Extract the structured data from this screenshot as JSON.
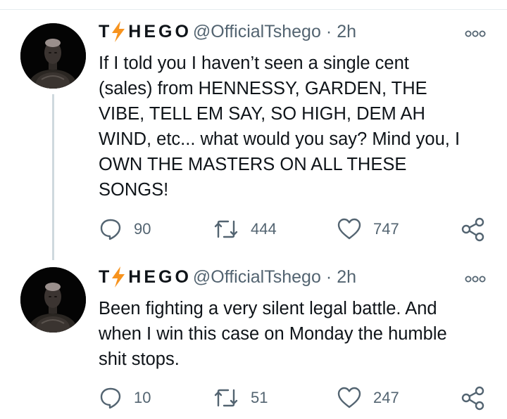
{
  "tweets": [
    {
      "name_pre": "T",
      "name_post": "HEGO",
      "handle": "@OfficialTshego",
      "separator": "·",
      "time": "2h",
      "text": "If I told you I haven’t seen a single cent\n(sales) from HENNESSY, GARDEN, THE\nVIBE, TELL EM SAY, SO HIGH, DEM AH\nWIND, etc... what would you say? Mind you, I\nOWN THE MASTERS ON ALL THESE\nSONGS!",
      "replies": "90",
      "retweets": "444",
      "likes": "747"
    },
    {
      "name_pre": "T",
      "name_post": "HEGO",
      "handle": "@OfficialTshego",
      "separator": "·",
      "time": "2h",
      "text": "Been fighting a very silent legal battle. And\nwhen I win this case on Monday the humble\nshit stops.",
      "replies": "10",
      "retweets": "51",
      "likes": "247"
    }
  ],
  "colors": {
    "text": "#0f1419",
    "secondary": "#536471",
    "bolt": "#f7931e",
    "thread_line": "#cfd9de"
  },
  "icons": [
    "reply-icon",
    "retweet-icon",
    "like-icon",
    "share-icon",
    "more-icon",
    "lightning-icon"
  ]
}
